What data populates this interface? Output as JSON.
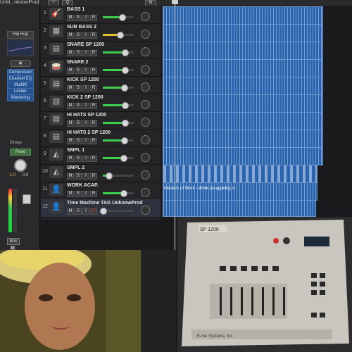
{
  "window": {
    "title": "Untit...nknowProd",
    "add_label": "+",
    "search_label": "Q",
    "gear_label": "⚙"
  },
  "inspector": {
    "eq_preset": "Hip Hop",
    "eye_label": "◉",
    "plugins": [
      "Compressor",
      "Channel EQ",
      "MultiM",
      "Limiter",
      "Mastering"
    ],
    "group_label": "Group",
    "automation_mode": "Read",
    "volume_value": "-1,0",
    "pan_value": "0,0",
    "bounce_label": "Bnc",
    "mute_label": "M"
  },
  "tracks": [
    {
      "num": "1",
      "icon": "guitar-icon",
      "glyph": "🎸",
      "name": "BASS 1",
      "fader": 0.62,
      "selected": false
    },
    {
      "num": "2",
      "icon": "synth-icon",
      "glyph": "▦",
      "name": "SUB BASS 2",
      "fader": 0.55,
      "selected": false
    },
    {
      "num": "3",
      "icon": "drum-machine-icon",
      "glyph": "▤",
      "name": "SNARE SP 1200",
      "fader": 0.7,
      "selected": false
    },
    {
      "num": "4",
      "icon": "drum-kit-icon",
      "glyph": "🥁",
      "name": "SNARE 2",
      "fader": 0.7,
      "selected": false
    },
    {
      "num": "5",
      "icon": "drum-machine-icon",
      "glyph": "▤",
      "name": "KICK SP 1200",
      "fader": 0.68,
      "selected": false
    },
    {
      "num": "6",
      "icon": "drum-machine-icon",
      "glyph": "▤",
      "name": "KICK 2 SP 1200",
      "fader": 0.7,
      "selected": false
    },
    {
      "num": "7",
      "icon": "drum-machine-icon",
      "glyph": "▤",
      "name": "HI HATS SP 1200",
      "fader": 0.7,
      "selected": false
    },
    {
      "num": "8",
      "icon": "drum-machine-icon",
      "glyph": "▤",
      "name": "HI HATS 2 SP 1200",
      "fader": 0.68,
      "selected": false
    },
    {
      "num": "9",
      "icon": "sampler-icon",
      "glyph": "◭",
      "name": "SMPL 1",
      "fader": 0.66,
      "selected": false
    },
    {
      "num": "10",
      "icon": "sampler-icon",
      "glyph": "◭",
      "name": "SMPL 2",
      "fader": 0.18,
      "selected": false
    },
    {
      "num": "11",
      "icon": "audio-track-icon",
      "glyph": "👤",
      "name": "WORK ACAP.",
      "fader": 0.66,
      "selected": false
    },
    {
      "num": "12",
      "icon": "audio-track-icon",
      "glyph": "👤",
      "name": "Time Machine TAG UnknowProd",
      "fader": 0.0,
      "selected": true
    }
  ],
  "track_buttons": {
    "mute": "M",
    "solo": "S",
    "input": "I",
    "record": "R"
  },
  "regions": {
    "acapella_label": "Masters of Work - Work (Acappella)  ⊙"
  },
  "colors": {
    "region_blue": "#2a64ad",
    "fader_green": "#3dcf4d",
    "plugin_blue": "#25538f"
  }
}
